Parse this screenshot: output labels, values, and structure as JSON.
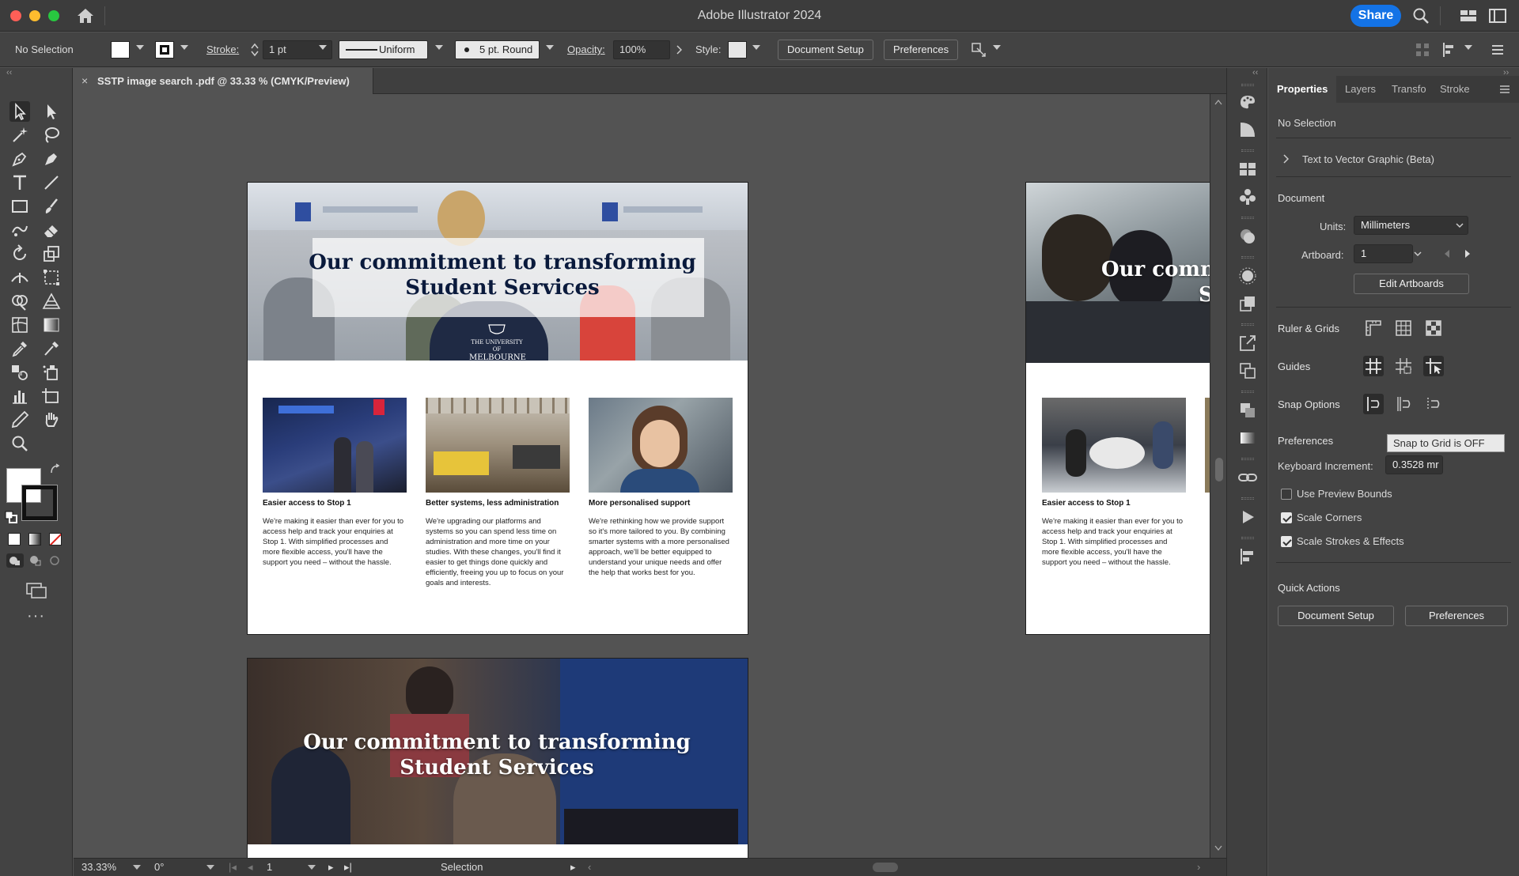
{
  "app": {
    "title": "Adobe Illustrator 2024",
    "share_label": "Share"
  },
  "control_bar": {
    "selection": "No Selection",
    "stroke_label": "Stroke:",
    "stroke_weight": "1 pt",
    "stroke_profile": "Uniform",
    "brush": "5 pt. Round",
    "opacity_label": "Opacity:",
    "opacity_value": "100%",
    "style_label": "Style:",
    "document_setup": "Document Setup",
    "preferences": "Preferences"
  },
  "document_tab": {
    "title": "SSTP image search .pdf @ 33.33 % (CMYK/Preview)",
    "close_glyph": "×"
  },
  "artboards": {
    "hero_title": "Our commitment to transforming Student Services",
    "hero_title_partial": "Our comm",
    "hero_title_partial2": "St",
    "logo_line1": "THE UNIVERSITY OF",
    "logo_line2": "MELBOURNE",
    "cards": [
      {
        "title": "Easier access to Stop 1",
        "body": "We're making it easier than ever for you to access help and track your enquiries at Stop 1. With simplified processes and more flexible access, you'll have the support you need – without the hassle."
      },
      {
        "title": "Better systems, less administration",
        "body": "We're upgrading our platforms and systems so you can spend less time on administration and more time on your studies. With these changes, you'll find it easier to get things done quickly and efficiently, freeing you up to focus on your goals and interests."
      },
      {
        "title": "More personalised support",
        "body": "We're rethinking how we provide support so it's more tailored to you. By combining smarter systems with a more personalised approach, we'll be better equipped to understand your unique needs and offer the help that works best for you."
      }
    ]
  },
  "status_bar": {
    "zoom": "33.33%",
    "rotation": "0°",
    "artboard": "1",
    "tool": "Selection"
  },
  "properties": {
    "tabs": [
      "Properties",
      "Layers",
      "Transfo",
      "Stroke"
    ],
    "selection": "No Selection",
    "text_to_vector": "Text to Vector Graphic (Beta)",
    "document_heading": "Document",
    "units_label": "Units:",
    "units_value": "Millimeters",
    "artboard_label": "Artboard:",
    "artboard_value": "1",
    "edit_artboards": "Edit Artboards",
    "ruler_grids": "Ruler & Grids",
    "guides": "Guides",
    "snap_options": "Snap Options",
    "preferences_heading": "Preferences",
    "keyboard_increment_label": "Keyboard Increment:",
    "keyboard_increment_value": "0.3528 mr",
    "use_preview_bounds": "Use Preview Bounds",
    "scale_corners": "Scale Corners",
    "scale_strokes_effects": "Scale Strokes & Effects",
    "quick_actions": "Quick Actions",
    "qa_document_setup": "Document Setup",
    "qa_preferences": "Preferences",
    "tooltip": "Snap to Grid is OFF"
  },
  "colors": {
    "accent": "#1473e6",
    "panel": "#434343",
    "canvas": "#535353",
    "hero_text": "#0a1a3c"
  }
}
